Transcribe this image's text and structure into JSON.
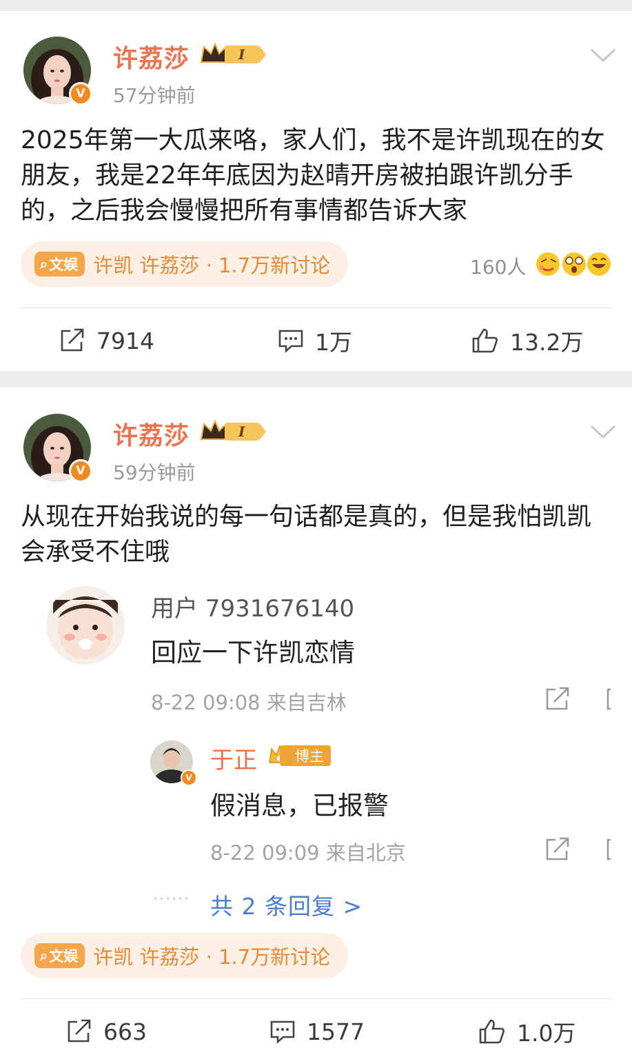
{
  "posts": [
    {
      "username": "许荔莎",
      "vip_level": "I",
      "time": "57分钟前",
      "text": "2025年第一大瓜来咯，家人们，我不是许凯现在的女朋友，我是22年年底因为赵晴开房被拍跟许凯分手的，之后我会慢慢把所有事情都告诉大家",
      "topic": {
        "badge": "文娱",
        "text": "许凯 许荔莎 · 1.7万新讨论"
      },
      "reactions": "160人",
      "actions": {
        "share": "7914",
        "comment": "1万",
        "like": "13.2万"
      }
    },
    {
      "username": "许荔莎",
      "vip_level": "I",
      "time": "59分钟前",
      "text": "从现在开始我说的每一句话都是真的，但是我怕凯凯会承受不住哦",
      "comment": {
        "user": "用户 7931676140",
        "text": "回应一下许凯恋情",
        "meta": "8-22 09:08 来自吉林",
        "reply": {
          "name": "于正",
          "badge": "博主",
          "text": "假消息，已报警",
          "meta": "8-22 09:09 来自北京"
        },
        "more_dots": "······",
        "more": "共 2 条回复 >"
      },
      "topic": {
        "badge": "文娱",
        "text": "许凯 许荔莎 · 1.7万新讨论"
      },
      "actions": {
        "share": "663",
        "comment": "1577",
        "like": "1.0万"
      }
    }
  ],
  "colors": {
    "username": "#eb7350",
    "topic_bg": "#fcefe3",
    "topic_text": "#e48935",
    "link": "#4a7bd0"
  }
}
